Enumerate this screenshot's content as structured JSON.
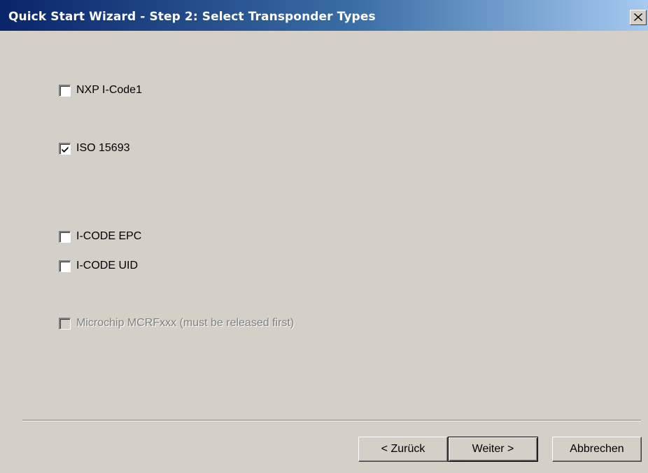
{
  "window": {
    "title": "Quick Start Wizard - Step 2: Select Transponder Types",
    "close_glyph": "✕"
  },
  "options": [
    {
      "label": "NXP I-Code1",
      "checked": false,
      "enabled": true
    },
    {
      "label": "ISO 15693",
      "checked": true,
      "enabled": true
    },
    {
      "label": "I-CODE EPC",
      "checked": false,
      "enabled": true
    },
    {
      "label": "I-CODE UID",
      "checked": false,
      "enabled": true
    },
    {
      "label": "Microchip MCRFxxx (must be released first)",
      "checked": false,
      "enabled": false
    }
  ],
  "buttons": {
    "back": "< Zurück",
    "next": "Weiter >",
    "cancel": "Abbrechen"
  },
  "icons": {
    "close": "close-icon",
    "check": "checkmark-icon"
  }
}
